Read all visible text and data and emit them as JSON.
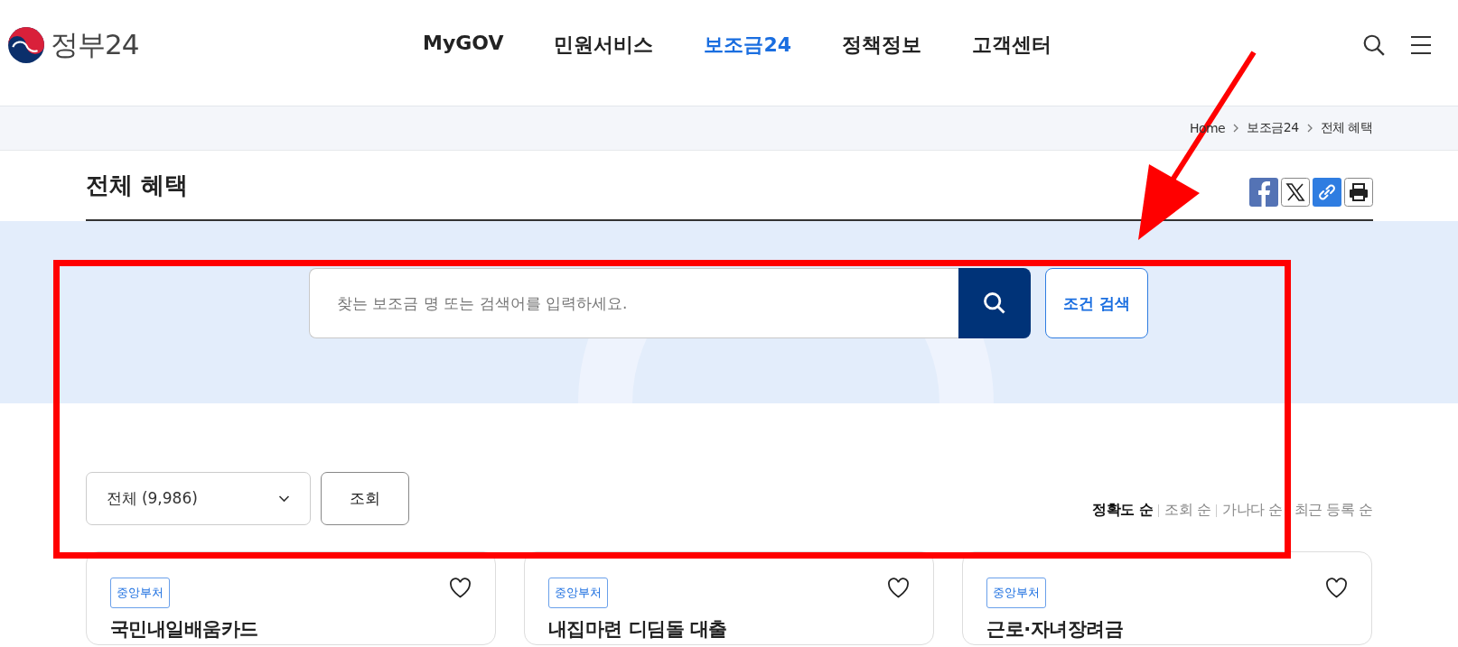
{
  "header": {
    "logo_text": "정부24",
    "nav": [
      {
        "label": "MyGOV",
        "selected": false
      },
      {
        "label": "민원서비스",
        "selected": false
      },
      {
        "label": "보조금24",
        "selected": true
      },
      {
        "label": "정책정보",
        "selected": false
      },
      {
        "label": "고객센터",
        "selected": false
      }
    ]
  },
  "breadcrumb": [
    "Home",
    "보조금24",
    "전체 혜택"
  ],
  "page_title": "전체 혜택",
  "search": {
    "placeholder": "찾는 보조금 명 또는 검색어를 입력하세요.",
    "filter_button": "조건 검색"
  },
  "filter": {
    "select_value": "전체 (9,986)",
    "submit_button": "조회"
  },
  "sort_options": [
    {
      "label": "정확도 순",
      "selected": true
    },
    {
      "label": "조회 순",
      "selected": false
    },
    {
      "label": "가나다 순",
      "selected": false
    },
    {
      "label": "최근 등록 순",
      "selected": false
    }
  ],
  "cards": [
    {
      "tag": "중앙부처",
      "title": "국민내일배움카드",
      "favorite": false
    },
    {
      "tag": "중앙부처",
      "title": "내집마련 디딤돌 대출",
      "favorite": false
    },
    {
      "tag": "중앙부처",
      "title": "근로·자녀장려금",
      "favorite": false
    }
  ]
}
